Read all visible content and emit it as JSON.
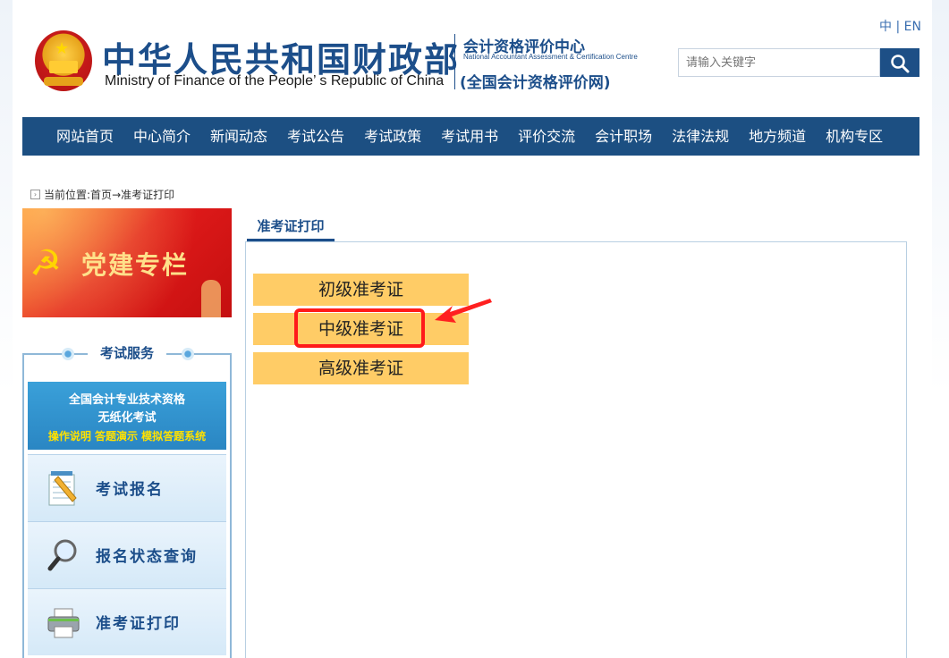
{
  "header": {
    "ministry_cn": "中华人民共和国财政部",
    "ministry_en": "Ministry of Finance of the People’ s Republic of China",
    "center_cn": "会计资格评价中心",
    "center_en": "National Accountant Assessment & Certification Centre",
    "center_net": "(全国会计资格评价网)",
    "lang_cn": "中",
    "lang_sep": "|",
    "lang_en": "EN",
    "search_placeholder": "请输入关键字"
  },
  "nav": {
    "items": [
      "网站首页",
      "中心简介",
      "新闻动态",
      "考试公告",
      "考试政策",
      "考试用书",
      "评价交流",
      "会计职场",
      "法律法规",
      "地方频道",
      "机构专区"
    ]
  },
  "breadcrumb": {
    "prefix": "当前位置:",
    "home": "首页",
    "arrow": "→",
    "current": "准考证打印"
  },
  "sidebar": {
    "party_banner": "党建专栏",
    "service_title": "考试服务",
    "paperless": {
      "line1": "全国会计专业技术资格",
      "line2": "无纸化考试",
      "line3": "操作说明 答题演示 模拟答题系统"
    },
    "items": [
      {
        "label": "考试报名",
        "icon": "notepad-pencil-icon"
      },
      {
        "label": "报名状态查询",
        "icon": "magnifier-icon"
      },
      {
        "label": "准考证打印",
        "icon": "printer-icon"
      }
    ]
  },
  "main": {
    "tab": "准考证打印",
    "certs": [
      "初级准考证",
      "中级准考证",
      "高级准考证"
    ]
  },
  "colors": {
    "nav_bg": "#1c4f82",
    "brand_blue": "#1c4e8a",
    "cert_bg": "#ffcc66",
    "highlight": "#ff1a1a"
  }
}
